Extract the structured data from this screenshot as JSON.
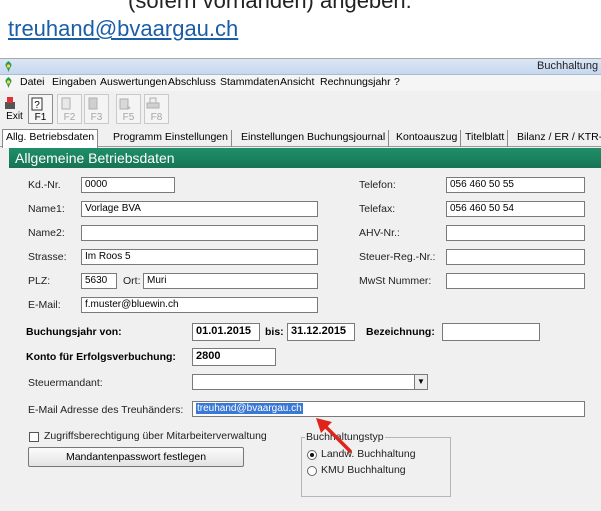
{
  "top": {
    "cut_text": "(sofern vorhanden) angeben:",
    "email_link": "treuhand@bvaargau.ch"
  },
  "window": {
    "title": "Buchhaltung"
  },
  "menu": [
    "Datei",
    "Eingaben",
    "Auswertungen",
    "Abschluss",
    "Stammdaten",
    "Ansicht",
    "Rechnungsjahr",
    "?"
  ],
  "toolbar": [
    {
      "label": "Exit",
      "icon": "exit-icon",
      "enabled": true
    },
    {
      "label": "F1",
      "icon": "help-icon",
      "enabled": true
    },
    {
      "label": "F2",
      "icon": "document-icon",
      "enabled": false
    },
    {
      "label": "F3",
      "icon": "document-icon",
      "enabled": false
    },
    {
      "label": "F5",
      "icon": "export-icon",
      "enabled": false
    },
    {
      "label": "F8",
      "icon": "printer-icon",
      "enabled": false
    }
  ],
  "tabs": [
    "Allg. Betriebsdaten",
    "Programm Einstellungen",
    "Einstellungen Buchungsjournal",
    "Kontoauszug",
    "Titelblatt",
    "Bilanz / ER / KTR-A"
  ],
  "section_title": "Allgemeine Betriebsdaten",
  "fields": {
    "kdnr_label": "Kd.-Nr.",
    "kdnr": "0000",
    "name1_label": "Name1:",
    "name1": "Vorlage BVA",
    "name2_label": "Name2:",
    "name2": "",
    "strasse_label": "Strasse:",
    "strasse": "Im Roos 5",
    "plz_label": "PLZ:",
    "plz": "5630",
    "ort_label": "Ort:",
    "ort": "Muri",
    "email_label": "E-Mail:",
    "email": "f.muster@bluewin.ch",
    "telefon_label": "Telefon:",
    "telefon": "056 460 50 55",
    "telefax_label": "Telefax:",
    "telefax": "056 460 50 54",
    "ahv_label": "AHV-Nr.:",
    "ahv": "",
    "steuer_label": "Steuer-Reg.-Nr.:",
    "steuer": "",
    "mwst_label": "MwSt Nummer:",
    "mwst": ""
  },
  "year": {
    "von_label": "Buchungsjahr von:",
    "von": "01.01.2015",
    "bis_label": "bis:",
    "bis": "31.12.2015",
    "bez_label": "Bezeichnung:",
    "bez": ""
  },
  "konto": {
    "label": "Konto für Erfolgsverbuchung:",
    "value": "2800"
  },
  "steuermandant": {
    "label": "Steuermandant:",
    "value": ""
  },
  "treuhand": {
    "label": "E-Mail Adresse des Treuhänders:",
    "value": "treuhand@bvaargau.ch"
  },
  "zugriff": {
    "label": "Zugriffsberechtigung über Mitarbeiterverwaltung",
    "checked": false
  },
  "passwort_button": "Mandantenpasswort festlegen",
  "buchhaltungstyp": {
    "title": "Buchhaltungstyp",
    "options": [
      {
        "label": "Landw. Buchhaltung",
        "selected": true
      },
      {
        "label": "KMU Buchhaltung",
        "selected": false
      }
    ]
  },
  "colors": {
    "header_green": "#1f8f68",
    "link_blue": "#1a5ea8",
    "arrow_red": "#e0241b",
    "selection": "#3a78d6"
  }
}
